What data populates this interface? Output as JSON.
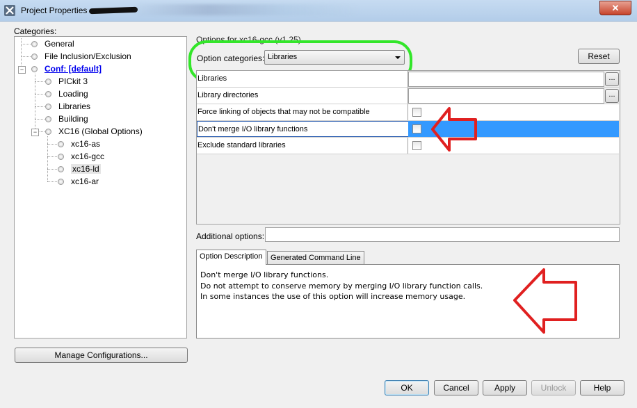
{
  "window": {
    "title": "Project Properties -",
    "close_label": "✕",
    "accent": "#3399ff"
  },
  "categories": {
    "label": "Categories:",
    "tree": [
      {
        "label": "General"
      },
      {
        "label": "File Inclusion/Exclusion"
      },
      {
        "label": "Conf: [default]"
      },
      {
        "label": "PICkit 3"
      },
      {
        "label": "Loading"
      },
      {
        "label": "Libraries"
      },
      {
        "label": "Building"
      },
      {
        "label": "XC16 (Global Options)"
      },
      {
        "label": "xc16-as"
      },
      {
        "label": "xc16-gcc"
      },
      {
        "label": "xc16-ld"
      },
      {
        "label": "xc16-ar"
      }
    ],
    "manage_button": "Manage Configurations..."
  },
  "options": {
    "title": "Options for xc16-gcc (v1.25)",
    "category_label": "Option categories:",
    "category_value": "Libraries",
    "reset_button": "Reset",
    "rows": [
      {
        "label": "Libraries",
        "ellipsis": "..."
      },
      {
        "label": "Library directories",
        "ellipsis": "..."
      },
      {
        "label": "Force linking of objects that may not be compatible"
      },
      {
        "label": "Don't merge I/O library functions"
      },
      {
        "label": "Exclude standard libraries"
      }
    ],
    "additional_label": "Additional options:",
    "additional_value": ""
  },
  "tabs": [
    {
      "label": "Option Description"
    },
    {
      "label": "Generated Command Line"
    }
  ],
  "description": [
    "Don't merge I/O library functions.",
    "Do not attempt to conserve memory by merging I/O library function calls.",
    "In some instances the use of this option will increase memory usage."
  ],
  "buttons": {
    "ok": "OK",
    "cancel": "Cancel",
    "apply": "Apply",
    "unlock": "Unlock",
    "help": "Help"
  }
}
